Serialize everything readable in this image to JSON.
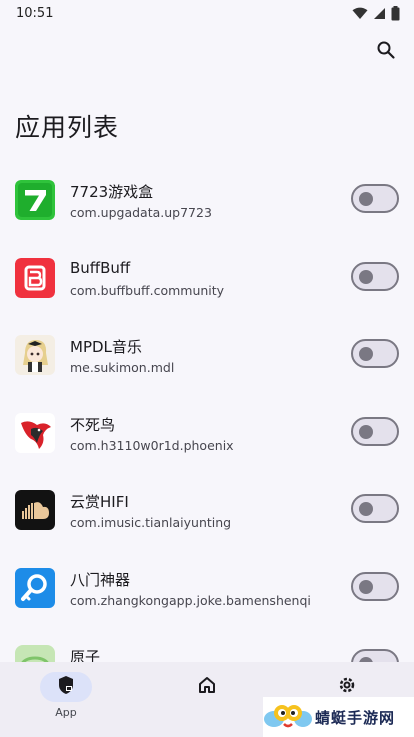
{
  "status_bar": {
    "time": "10:51"
  },
  "title": "应用列表",
  "apps": [
    {
      "name": "7723游戏盒",
      "package": "com.upgadata.up7723",
      "icon": "7723-icon",
      "enabled": false
    },
    {
      "name": "BuffBuff",
      "package": "com.buffbuff.community",
      "icon": "buffbuff-icon",
      "enabled": false
    },
    {
      "name": "MPDL音乐",
      "package": "me.sukimon.mdl",
      "icon": "mpdl-icon",
      "enabled": false
    },
    {
      "name": "不死鸟",
      "package": "com.h3110w0r1d.phoenix",
      "icon": "phoenix-icon",
      "enabled": false
    },
    {
      "name": "云赏HIFI",
      "package": "com.imusic.tianlaiyunting",
      "icon": "yunshang-icon",
      "enabled": false
    },
    {
      "name": "八门神器",
      "package": "com.zhangkongapp.joke.bamenshenqi",
      "icon": "bamen-icon",
      "enabled": false
    },
    {
      "name": "原子",
      "package": "",
      "icon": "yuanzi-icon",
      "enabled": false
    }
  ],
  "bottom_nav": {
    "items": [
      {
        "label": "App",
        "icon": "shield-lock-icon",
        "active": true
      },
      {
        "label": "",
        "icon": "home-icon",
        "active": false
      },
      {
        "label": "",
        "icon": "settings-icon",
        "active": false
      }
    ]
  },
  "watermark": {
    "text": "蜻蜓手游网"
  },
  "colors": {
    "background": "#f7f6fb",
    "nav_background": "#efedf4",
    "nav_active_pill": "#dce2f9",
    "toggle_outline": "#7a7883"
  }
}
